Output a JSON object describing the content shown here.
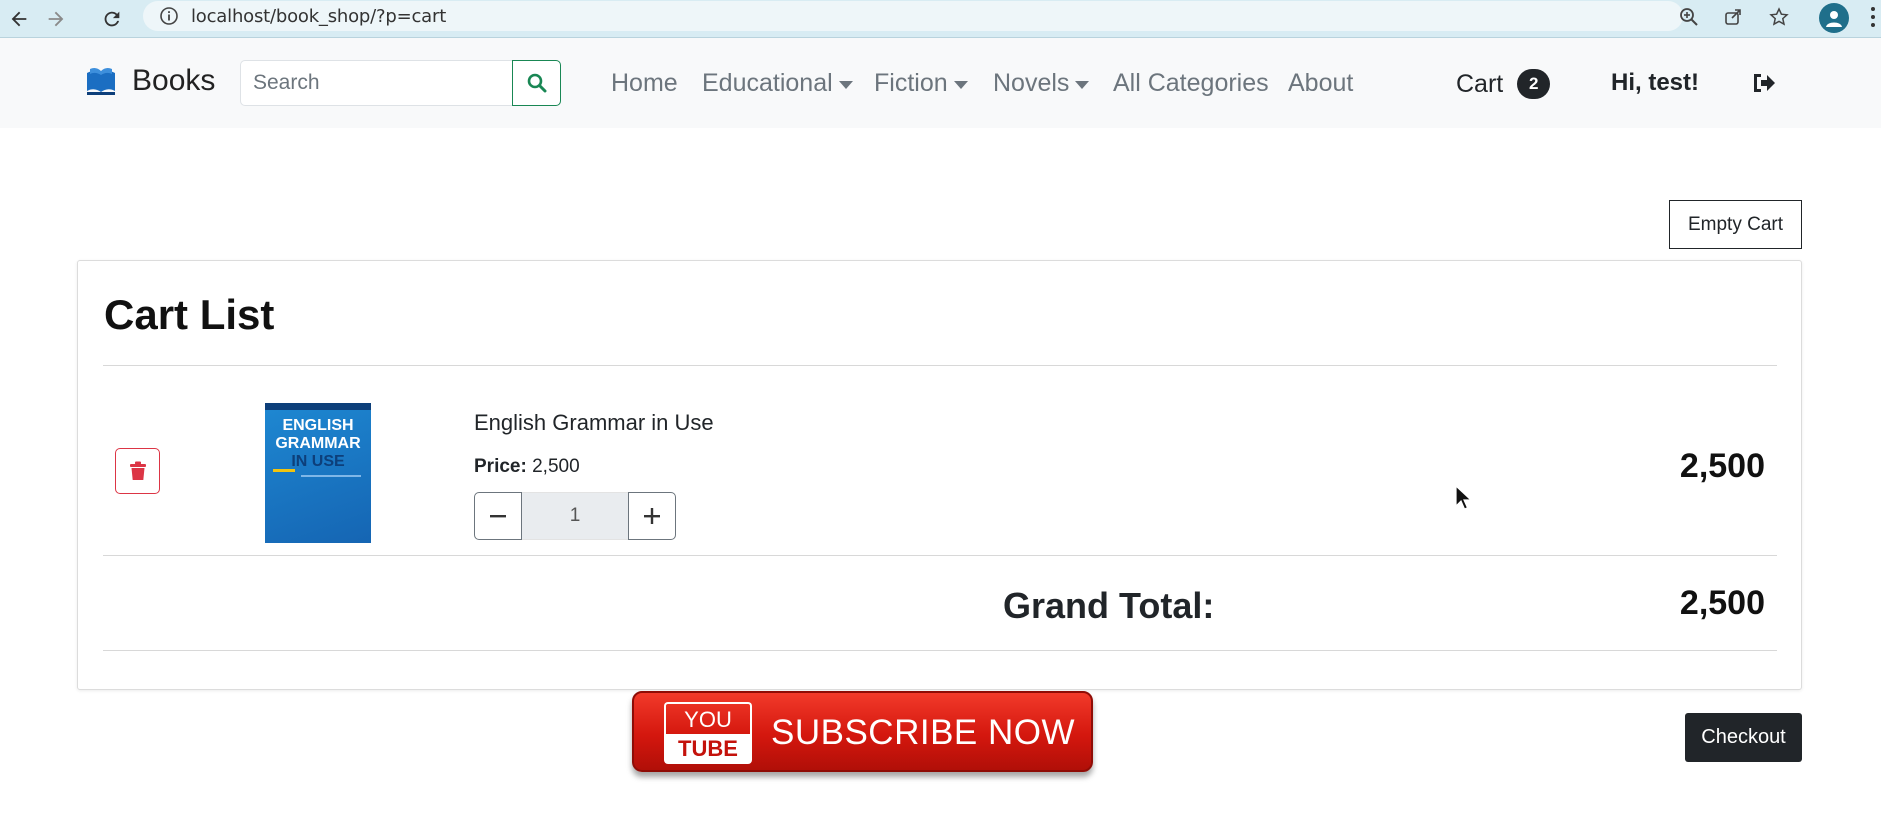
{
  "browser": {
    "url": "localhost/book_shop/?p=cart"
  },
  "navbar": {
    "brand": "Books",
    "search": {
      "placeholder": "Search",
      "value": ""
    },
    "links": [
      {
        "label": "Home"
      },
      {
        "label": "Educational"
      },
      {
        "label": "Fiction"
      },
      {
        "label": "Novels"
      },
      {
        "label": "All Categories"
      },
      {
        "label": "About"
      }
    ],
    "cart": {
      "label": "Cart",
      "count": "2"
    },
    "greeting": "Hi, test!"
  },
  "toolbar": {
    "empty_cart_label": "Empty Cart"
  },
  "cart": {
    "title": "Cart List",
    "items": [
      {
        "name": "English Grammar in Use",
        "price_label": "Price:",
        "price": "2,500",
        "quantity": "1",
        "total": "2,500",
        "cover": {
          "line1": "ENGLISH",
          "line2": "GRAMMAR",
          "line3": "IN USE"
        }
      }
    ],
    "grand_total_label": "Grand Total:",
    "grand_total": "2,500"
  },
  "banner": {
    "you": "YOU",
    "tube": "TUBE",
    "text": "SUBSCRIBE NOW"
  },
  "checkout_label": "Checkout",
  "colors": {
    "primary_dark": "#212529",
    "danger": "#dc3545",
    "success": "#198754",
    "banner_red": "#d4170e"
  }
}
